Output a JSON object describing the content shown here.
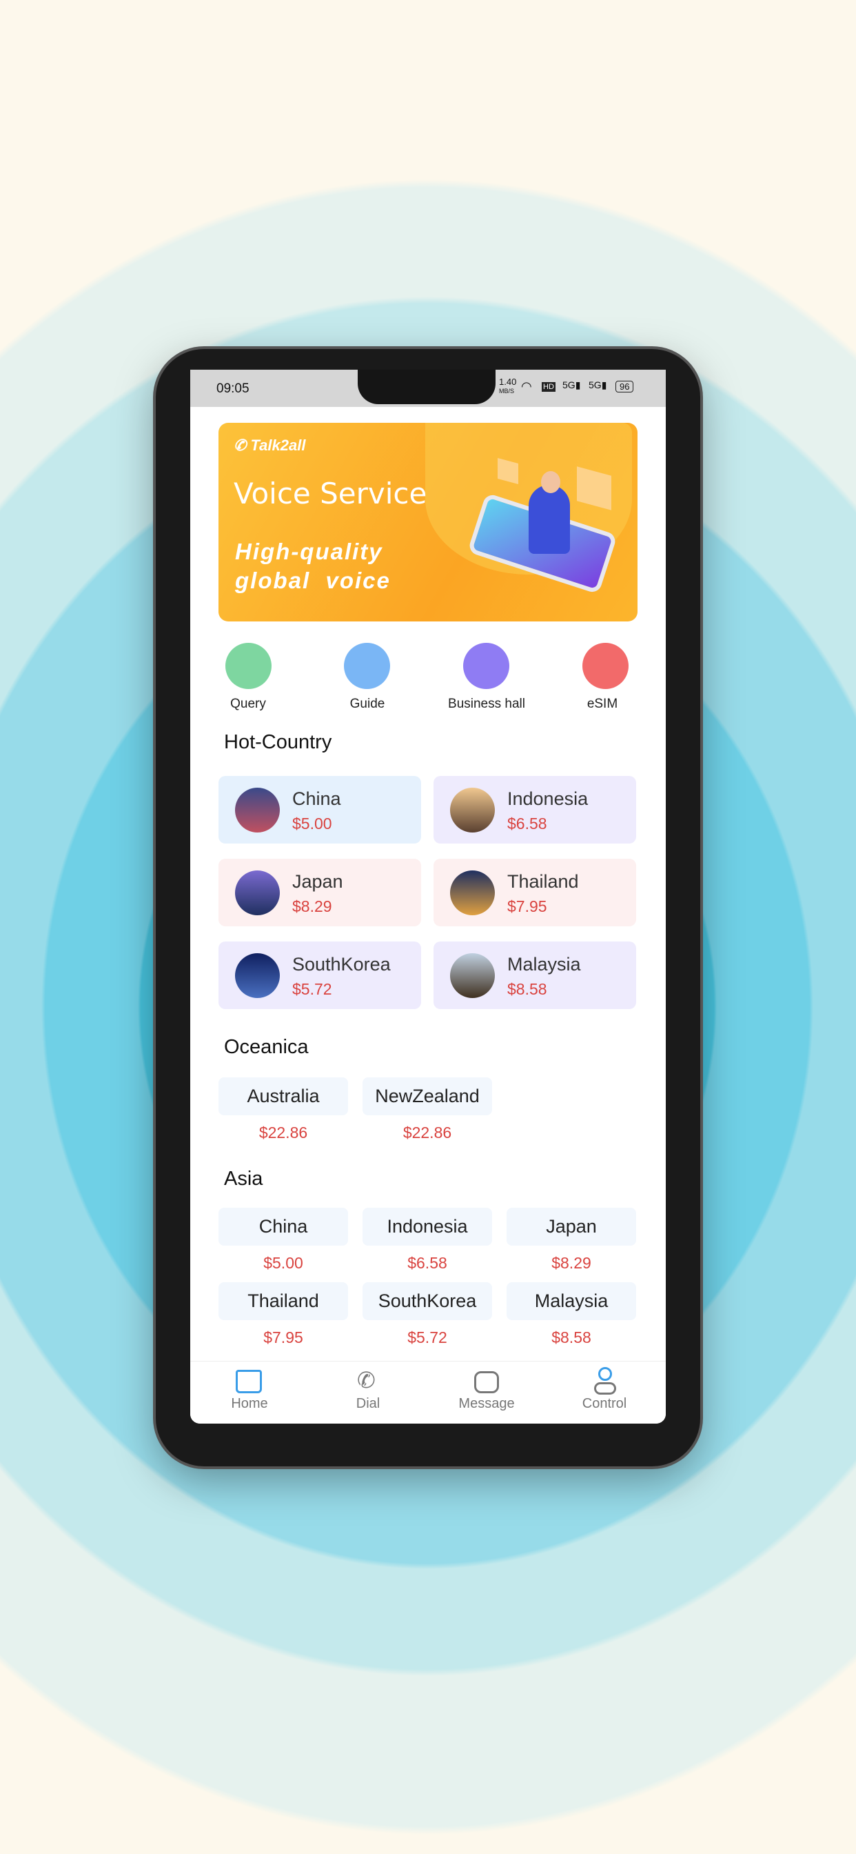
{
  "status": {
    "time": "09:05",
    "speed": "1.40",
    "speed_unit": "MB/S",
    "network": "5G",
    "battery": "96"
  },
  "banner": {
    "brand": "Talk2all",
    "title": "Voice Service",
    "subtitle_line1": "High-quality",
    "subtitle_line2": "global  voice"
  },
  "quick_actions": [
    {
      "label": "Query",
      "icon": "search-icon",
      "color": "#7ed6a0"
    },
    {
      "label": "Guide",
      "icon": "document-icon",
      "color": "#7ab6f5"
    },
    {
      "label": "Business hall",
      "icon": "store-icon",
      "color": "#8f7cf3"
    },
    {
      "label": "eSIM",
      "icon": "sim-card-icon",
      "color": "#f26a6a"
    }
  ],
  "hot_country": {
    "title": "Hot-Country",
    "items": [
      {
        "name": "China",
        "price": "$5.00",
        "bg": "#e5f1fd"
      },
      {
        "name": "Indonesia",
        "price": "$6.58",
        "bg": "#eeebfd"
      },
      {
        "name": "Japan",
        "price": "$8.29",
        "bg": "#fdf0f0"
      },
      {
        "name": "Thailand",
        "price": "$7.95",
        "bg": "#fdf0f0"
      },
      {
        "name": "SouthKorea",
        "price": "$5.72",
        "bg": "#eeebfd"
      },
      {
        "name": "Malaysia",
        "price": "$8.58",
        "bg": "#eeebfd"
      }
    ]
  },
  "oceanica": {
    "title": "Oceanica",
    "items": [
      {
        "name": "Australia",
        "price": "$22.86"
      },
      {
        "name": "NewZealand",
        "price": "$22.86"
      }
    ]
  },
  "asia": {
    "title": "Asia",
    "items": [
      {
        "name": "China",
        "price": "$5.00"
      },
      {
        "name": "Indonesia",
        "price": "$6.58"
      },
      {
        "name": "Japan",
        "price": "$8.29"
      },
      {
        "name": "Thailand",
        "price": "$7.95"
      },
      {
        "name": "SouthKorea",
        "price": "$5.72"
      },
      {
        "name": "Malaysia",
        "price": "$8.58"
      }
    ]
  },
  "nav": {
    "active": "Home",
    "active_color": "#3a9de8",
    "items": [
      {
        "label": "Home"
      },
      {
        "label": "Dial"
      },
      {
        "label": "Message"
      },
      {
        "label": "Control"
      }
    ]
  }
}
